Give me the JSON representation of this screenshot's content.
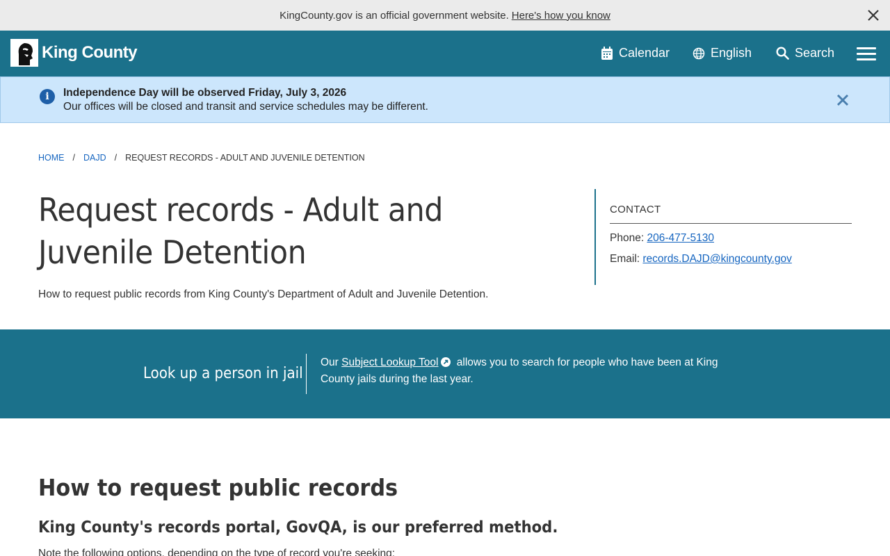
{
  "official_banner": {
    "text": "KingCounty.gov is an official government website.",
    "link": "Here's how you know"
  },
  "header": {
    "logo_text": "King County",
    "nav": {
      "calendar": "Calendar",
      "language": "English",
      "search": "Search"
    },
    "colors": {
      "header_bg": "#1b718b"
    }
  },
  "alert": {
    "title": "Independence Day will be observed Friday, July 3, 2026",
    "body": "Our offices will be closed and transit and service schedules may be different."
  },
  "breadcrumb": {
    "home": "HOME",
    "parent": "DAJD",
    "current": "REQUEST RECORDS - ADULT AND JUVENILE DETENTION",
    "separator": "/"
  },
  "page": {
    "title": "Request records - Adult and Juvenile Detention",
    "description": "How to request public records from King County's Department of Adult and Juvenile Detention."
  },
  "contact": {
    "heading": "CONTACT",
    "phone_label": "Phone:",
    "phone": "206-477-5130",
    "email_label": "Email:",
    "email": "records.DAJD@kingcounty.gov"
  },
  "lookup": {
    "title": "Look up a person in jail",
    "text_before": "Our",
    "link": "Subject Lookup Tool",
    "text_after": "allows you to search for people who have been at King County jails during the last year."
  },
  "section": {
    "title": "How to request public records",
    "subtitle": "King County's records portal, GovQA, is our preferred method.",
    "note": "Note the following options, depending on the type of record you're seeking:"
  }
}
